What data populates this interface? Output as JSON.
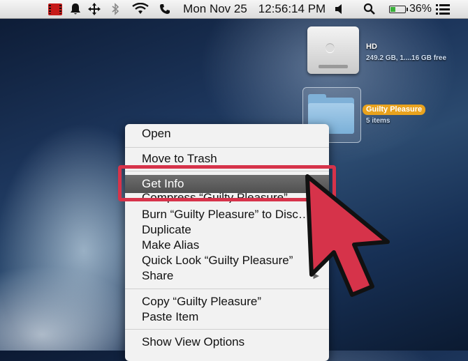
{
  "menubar": {
    "date": "Mon Nov 25",
    "time": "12:56:14 PM",
    "battery_percent": "36%",
    "battery_level": 0.36,
    "icons": [
      "screen-recorder-icon",
      "notification-icon",
      "move-icon",
      "bluetooth-icon",
      "wifi-icon",
      "phone-icon",
      "volume-icon",
      "search-icon",
      "battery-icon",
      "list-icon"
    ]
  },
  "desktop": {
    "drive": {
      "name": "HD",
      "info": "249.2 GB, 1....16 GB free"
    },
    "folder": {
      "name": "Guilty Pleasure",
      "info": "5 items"
    }
  },
  "context_menu": {
    "items": [
      {
        "label": "Open"
      },
      {
        "label": "Move to Trash"
      },
      {
        "label": "Get Info",
        "highlighted": true
      },
      {
        "label": "Compress “Guilty Pleasure”"
      },
      {
        "label": "Burn “Guilty Pleasure” to Disc…"
      },
      {
        "label": "Duplicate"
      },
      {
        "label": "Make Alias"
      },
      {
        "label": "Quick Look “Guilty Pleasure”"
      },
      {
        "label": "Share"
      },
      {
        "label": "Copy “Guilty Pleasure”"
      },
      {
        "label": "Paste Item"
      },
      {
        "label": "Show View Options"
      }
    ]
  },
  "colors": {
    "highlight_box": "#d6334a",
    "cursor": "#d6334a",
    "selection_label": "#e9a21d"
  }
}
